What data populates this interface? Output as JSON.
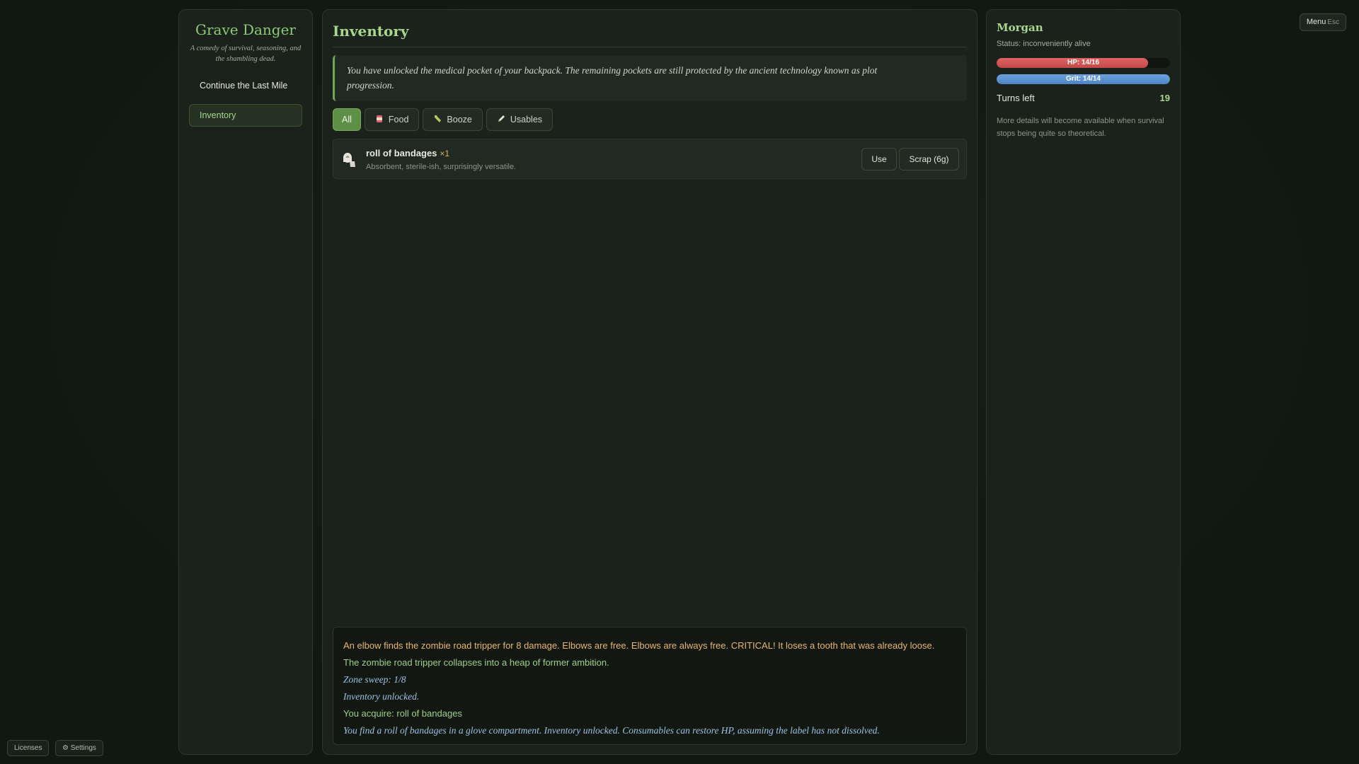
{
  "sidebar": {
    "title": "Grave Danger",
    "subtitle": "A comedy of survival, seasoning, and the shambling dead.",
    "items": [
      {
        "label": "Continue the Last Mile"
      },
      {
        "label": "Inventory"
      }
    ]
  },
  "main": {
    "title": "Inventory",
    "notice": "You have unlocked the medical pocket of your backpack. The remaining pockets are still protected by the ancient technology known as plot progression.",
    "filters": [
      {
        "label": "All",
        "icon": ""
      },
      {
        "label": "Food",
        "icon": "food-can-icon"
      },
      {
        "label": "Booze",
        "icon": "bottle-icon"
      },
      {
        "label": "Usables",
        "icon": "pencil-icon"
      }
    ],
    "items": [
      {
        "icon": "bandage-roll-icon",
        "name": "roll of bandages",
        "qty": "×1",
        "desc": "Absorbent, sterile-ish, surprisingly versatile.",
        "use_label": "Use",
        "scrap_label": "Scrap (6g)"
      }
    ],
    "log": [
      "An elbow finds the zombie road tripper for 8 damage. Elbows are free. Elbows are always free. CRITICAL! It loses a tooth that was already loose.",
      "The zombie road tripper collapses into a heap of former ambition.",
      "Zone sweep: 1/8",
      "Inventory unlocked.",
      "You acquire: roll of bandages",
      "You find a roll of bandages in a glove compartment. Inventory unlocked. Consumables can restore HP, assuming the label has not dissolved."
    ]
  },
  "character": {
    "name": "Morgan",
    "status": "Status: inconveniently alive",
    "hp": {
      "label": "HP: 14/16",
      "current": 14,
      "max": 16
    },
    "grit": {
      "label": "Grit: 14/14",
      "current": 14,
      "max": 14
    },
    "turns_label": "Turns left",
    "turns_value": "19",
    "note": "More details will become available when survival stops being quite so theoretical."
  },
  "menu": {
    "label": "Menu",
    "key": "Esc"
  },
  "footer": {
    "licenses": "Licenses",
    "settings": "⚙ Settings"
  },
  "colors": {
    "accent": "#a8d68c",
    "hp": "#d85656",
    "grit": "#5e92d2",
    "log_damage": "#e8b66a",
    "log_event": "#9fcf88",
    "log_info": "#9cc0e4"
  }
}
